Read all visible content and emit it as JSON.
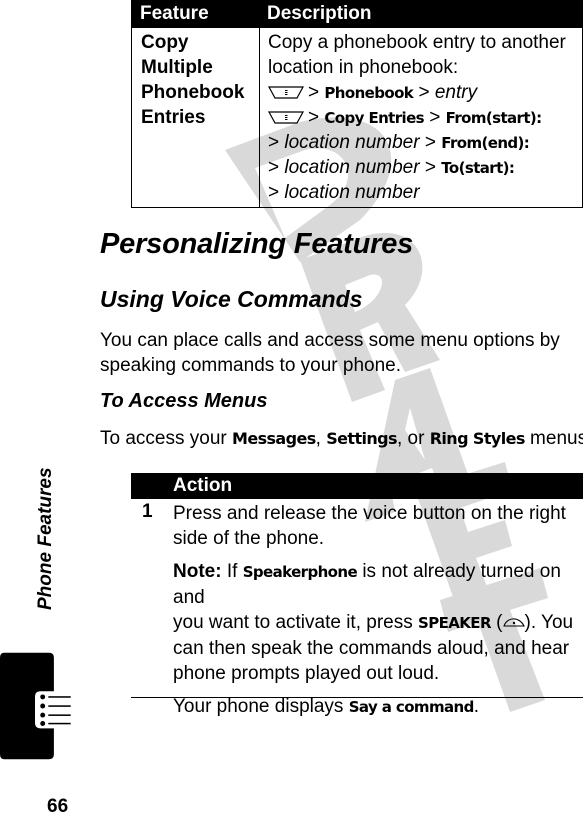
{
  "watermark": {
    "text": "DRAFT",
    "color": "#d9d9d9"
  },
  "feature_table": {
    "headers": [
      "Feature",
      "Description"
    ],
    "rows": [
      {
        "feature_lines": [
          "Copy",
          "Multiple",
          "Phonebook",
          "Entries"
        ],
        "description": {
          "intro_lines": [
            "Copy a phonebook entry to another",
            "location in phonebook:"
          ],
          "path1": {
            "icon": "menu-key-icon",
            "sep": ">",
            "item": "Phonebook",
            "sep2": ">",
            "target": "entry"
          },
          "path2": {
            "icon": "menu-key-icon",
            "sep": ">",
            "item": "Copy Entries",
            "sep2": ">",
            "target": "From(start):"
          },
          "path3": {
            "sep": ">",
            "target": "location number",
            "sep2": ">",
            "item": "From(end):"
          },
          "path4": {
            "sep": ">",
            "target": "location number",
            "sep2": ">",
            "item": "To(start):"
          },
          "path5": {
            "sep": ">",
            "target": "location number"
          }
        }
      }
    ]
  },
  "section": {
    "title": "Personalizing Features",
    "subtitle": "Using Voice Commands",
    "intro_lines": [
      "You can place calls and access some menu options by",
      "speaking commands to your phone."
    ],
    "subsubtitle": "To Access Menus",
    "access_text": {
      "before": "To access your ",
      "m1": "Messages",
      "c1": ", ",
      "m2": "Settings",
      "c2": ", or ",
      "m3": "Ring Styles",
      "after": " menus:"
    }
  },
  "action_table": {
    "header": "Action",
    "steps": [
      {
        "number": "1",
        "main_lines": [
          "Press and release the voice button on the right",
          "side of the phone."
        ],
        "note": {
          "label": "Note:",
          "l1a": " If ",
          "l1b": "Speakerphone",
          "l1c": " is not already turned on and",
          "l2a": "you want to activate it, press ",
          "l2b": "SPEAKER",
          "l2c": " (",
          "l2d": "). You",
          "l3": "can then speak the commands aloud, and hear",
          "l4": "phone prompts played out loud."
        },
        "display": {
          "before": "Your phone displays ",
          "value": "Say a command",
          "after": "."
        }
      }
    ]
  },
  "sidebar": {
    "chapter_label": "Phone Features",
    "tab_icon": "list-tab-icon"
  },
  "footer": {
    "page_number": "66"
  }
}
